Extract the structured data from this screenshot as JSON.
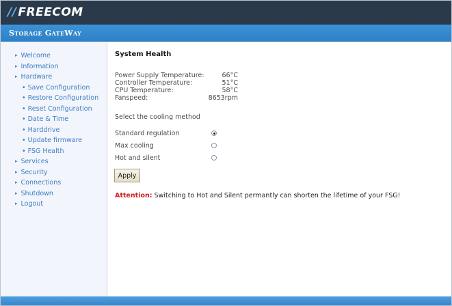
{
  "brand": {
    "logo_mark": "//",
    "logo_text": "FREECOM",
    "product_title": "Storage GateWay"
  },
  "sidebar": {
    "items": [
      {
        "label": "Welcome",
        "level": "top"
      },
      {
        "label": "Information",
        "level": "top"
      },
      {
        "label": "Hardware",
        "level": "top"
      },
      {
        "label": "Save Configuration",
        "level": "sub"
      },
      {
        "label": "Restore Configuration",
        "level": "sub"
      },
      {
        "label": "Reset Configuration",
        "level": "sub"
      },
      {
        "label": "Date & Time",
        "level": "sub"
      },
      {
        "label": "Harddrive",
        "level": "sub"
      },
      {
        "label": "Update firmware",
        "level": "sub"
      },
      {
        "label": "FSG Health",
        "level": "sub"
      },
      {
        "label": "Services",
        "level": "top"
      },
      {
        "label": "Security",
        "level": "top"
      },
      {
        "label": "Connections",
        "level": "top"
      },
      {
        "label": "Shutdown",
        "level": "top"
      },
      {
        "label": "Logout",
        "level": "top"
      }
    ]
  },
  "main": {
    "title": "System Health",
    "readings": [
      {
        "label": "Power Supply Temperature:",
        "value": "66°C"
      },
      {
        "label": "Controller Temperature:",
        "value": "51°C"
      },
      {
        "label": "CPU Temperature:",
        "value": "58°C"
      },
      {
        "label": "Fanspeed:",
        "value": "8653rpm"
      }
    ],
    "cooling_prompt": "Select the cooling method",
    "cooling_options": [
      {
        "label": "Standard regulation",
        "selected": true
      },
      {
        "label": "Max cooling",
        "selected": false
      },
      {
        "label": "Hot and silent",
        "selected": false
      }
    ],
    "apply_label": "Apply",
    "attention_label": "Attention:",
    "attention_text": " Switching to Hot and Silent permantly can shorten the lifetime of your FSG!"
  },
  "colors": {
    "topbar": "#2b3a4a",
    "titlebar": "#3b93d8",
    "nav_link": "#3d7ec6",
    "attention": "#cc1f1f"
  }
}
